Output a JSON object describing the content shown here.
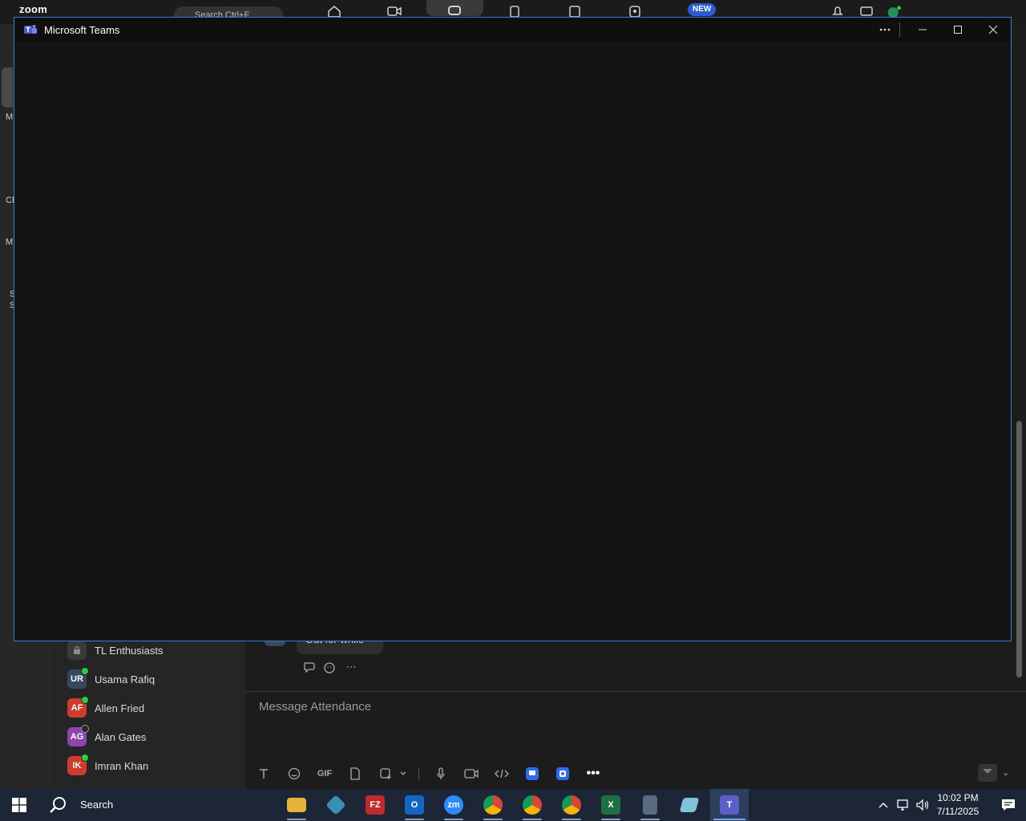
{
  "zoom": {
    "logo": "zoom",
    "new_badge": "NEW",
    "search_placeholder": "Search  Ctrl+F",
    "rail_letters": [
      "M",
      "Ch",
      "M",
      "S",
      "S"
    ],
    "sidebar": {
      "items": [
        {
          "initials": "",
          "name": "TL Enthusiasts",
          "type": "channel"
        },
        {
          "initials": "UR",
          "name": "Usama Rafiq",
          "color": "#34495e",
          "presence": "#2ecc40"
        },
        {
          "initials": "AF",
          "name": "Allen Fried",
          "color": "#d13a2f",
          "presence": "#2ecc40"
        },
        {
          "initials": "AG",
          "name": "Alan Gates",
          "color": "#8e44ad",
          "presence": "#9a9a9a"
        },
        {
          "initials": "IK",
          "name": "Imran Khan",
          "color": "#d13a2f",
          "presence": "#2ecc40"
        }
      ]
    },
    "message_preview": "Out for while",
    "compose_placeholder": "Message Attendance",
    "toolbar_gif": "GIF"
  },
  "teams": {
    "title": "Microsoft Teams"
  },
  "taskbar": {
    "search_label": "Search",
    "apps": [
      {
        "name": "file-explorer",
        "label": "",
        "color": "#e8b33a"
      },
      {
        "name": "app-diamond",
        "label": "",
        "color": "#3a8fb7"
      },
      {
        "name": "filezilla",
        "label": "FZ",
        "color": "#bf2a2a"
      },
      {
        "name": "outlook",
        "label": "O",
        "color": "#1266c4"
      },
      {
        "name": "zoom",
        "label": "zm",
        "color": "#2d8cff"
      },
      {
        "name": "chrome-1",
        "label": "",
        "color": "#db4437"
      },
      {
        "name": "chrome-2",
        "label": "",
        "color": "#db4437"
      },
      {
        "name": "chrome-3",
        "label": "",
        "color": "#db4437"
      },
      {
        "name": "excel",
        "label": "X",
        "color": "#1d7044"
      },
      {
        "name": "calculator",
        "label": "",
        "color": "#5a6b80"
      },
      {
        "name": "notes",
        "label": "",
        "color": "#7fc4d8"
      },
      {
        "name": "teams",
        "label": "T",
        "color": "#5b5fc7"
      }
    ],
    "time": "10:02 PM",
    "date": "7/11/2025"
  }
}
